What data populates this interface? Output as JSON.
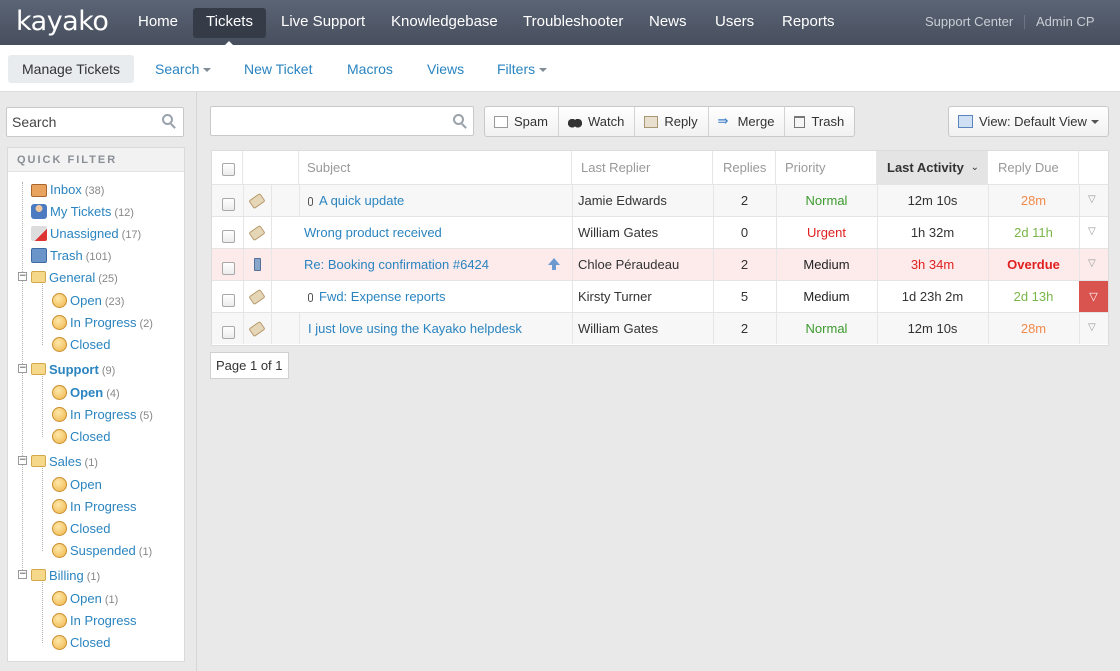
{
  "app": {
    "logo": "kayako",
    "top_nav": [
      "Home",
      "Tickets",
      "Live Support",
      "Knowledgebase",
      "Troubleshooter",
      "News",
      "Users",
      "Reports"
    ],
    "active_top": "Tickets",
    "right_links": [
      "Support Center",
      "Admin CP"
    ]
  },
  "subnav": {
    "items": [
      "Manage Tickets",
      "Search",
      "New Ticket",
      "Macros",
      "Views",
      "Filters"
    ],
    "active": "Manage Tickets"
  },
  "sidebar": {
    "search_placeholder": "Search",
    "quick_filter_title": "QUICK FILTER",
    "tree": [
      {
        "label": "Inbox",
        "count": "(38)"
      },
      {
        "label": "My Tickets",
        "count": "(12)"
      },
      {
        "label": "Unassigned",
        "count": "(17)"
      },
      {
        "label": "Trash",
        "count": "(101)"
      },
      {
        "label": "General",
        "count": "(25)"
      },
      {
        "label": "Open",
        "count": "(23)"
      },
      {
        "label": "In Progress",
        "count": "(2)"
      },
      {
        "label": "Closed",
        "count": ""
      },
      {
        "label": "Support",
        "count": "(9)"
      },
      {
        "label": "Open",
        "count": "(4)"
      },
      {
        "label": "In Progress",
        "count": "(5)"
      },
      {
        "label": "Closed",
        "count": ""
      },
      {
        "label": "Sales",
        "count": "(1)"
      },
      {
        "label": "Open",
        "count": ""
      },
      {
        "label": "In Progress",
        "count": ""
      },
      {
        "label": "Closed",
        "count": ""
      },
      {
        "label": "Suspended",
        "count": "(1)"
      },
      {
        "label": "Billing",
        "count": "(1)"
      },
      {
        "label": "Open",
        "count": "(1)"
      },
      {
        "label": "In Progress",
        "count": ""
      },
      {
        "label": "Closed",
        "count": ""
      }
    ]
  },
  "toolbar": {
    "buttons": [
      "Spam",
      "Watch",
      "Reply",
      "Merge",
      "Trash"
    ],
    "view_label": "View: Default View"
  },
  "grid": {
    "columns": [
      "Subject",
      "Last Replier",
      "Replies",
      "Priority",
      "Last Activity",
      "Reply Due"
    ],
    "rows": [
      {
        "subject": "A quick update",
        "last_replier": "Jamie Edwards",
        "replies": "2",
        "priority": "Normal",
        "last_activity": "12m 10s",
        "reply_due": "28m",
        "priority_color": "#3c9a2f",
        "activity_color": "#333333",
        "due_color": "#f08a4b"
      },
      {
        "subject": "Wrong product received",
        "last_replier": "William Gates",
        "replies": "0",
        "priority": "Urgent",
        "last_activity": "1h 32m",
        "reply_due": "2d 11h",
        "priority_color": "#e02020",
        "activity_color": "#333333",
        "due_color": "#7ab648"
      },
      {
        "subject": "Re: Booking confirmation #6424",
        "last_replier": "Chloe Péraudeau",
        "replies": "2",
        "priority": "Medium",
        "last_activity": "3h 34m",
        "reply_due": "Overdue",
        "priority_color": "#222222",
        "activity_color": "#e02020",
        "due_color": "#e02020"
      },
      {
        "subject": "Fwd: Expense reports",
        "last_replier": "Kirsty Turner",
        "replies": "5",
        "priority": "Medium",
        "last_activity": "1d 23h 2m",
        "reply_due": "2d 13h",
        "priority_color": "#222222",
        "activity_color": "#333333",
        "due_color": "#7ab648"
      },
      {
        "subject": "I just love using the Kayako helpdesk",
        "last_replier": "William Gates",
        "replies": "2",
        "priority": "Normal",
        "last_activity": "12m 10s",
        "reply_due": "28m",
        "priority_color": "#3c9a2f",
        "activity_color": "#333333",
        "due_color": "#f08a4b"
      }
    ]
  },
  "pager": "Page 1 of 1"
}
